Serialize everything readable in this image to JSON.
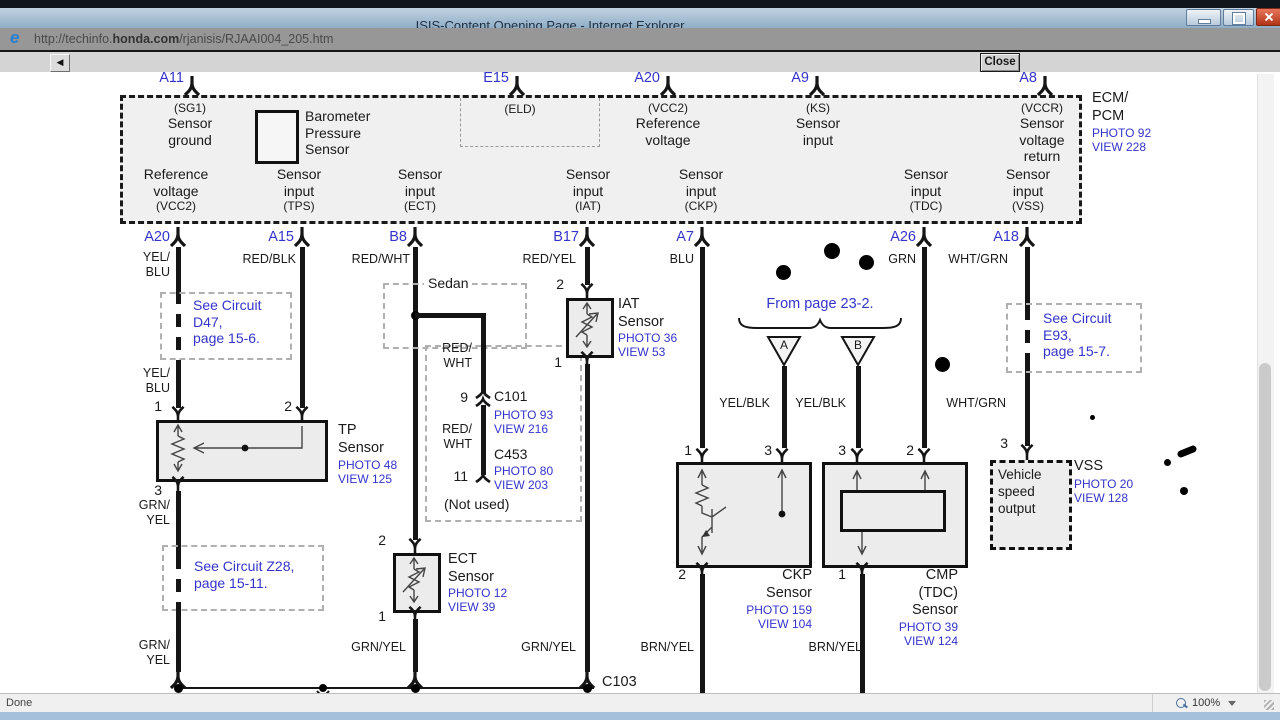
{
  "window": {
    "title": "ISIS-Content Opening Page - Internet Explorer",
    "ie_logo": "e",
    "url_prefix": "http://techinfo.",
    "url_domain": "honda.com",
    "url_suffix": "/rjanisis/RJAAI004_205.htm"
  },
  "toolbar": {
    "back_icon": "◀",
    "close_label": "Close"
  },
  "statusbar": {
    "status": "Done",
    "zoom_level": "100%"
  },
  "ecm": {
    "title": "ECM/\nPCM",
    "photo": "PHOTO 92",
    "view": "VIEW 228",
    "barometer_label": "Barometer\nPressure\nSensor",
    "top_pins": [
      {
        "id": "A11",
        "sub": "(SG1)",
        "label": "Sensor\nground"
      },
      {
        "id": "E15",
        "sub": "(ELD)",
        "label": ""
      },
      {
        "id": "A20",
        "sub": "(VCC2)",
        "label": "Reference\nvoltage"
      },
      {
        "id": "A9",
        "sub": "(KS)",
        "label": "Sensor\ninput"
      },
      {
        "id": "A8",
        "sub": "(VCCR)",
        "label": "Sensor\nvoltage\nreturn"
      }
    ],
    "bottom_pins": [
      {
        "id": "A20",
        "label": "Reference\nvoltage",
        "sub": "(VCC2)",
        "wire": "YEL/\nBLU"
      },
      {
        "id": "A15",
        "label": "Sensor\ninput",
        "sub": "(TPS)",
        "wire": "RED/BLK"
      },
      {
        "id": "B8",
        "label": "Sensor\ninput",
        "sub": "(ECT)",
        "wire": "RED/WHT"
      },
      {
        "id": "B17",
        "label": "Sensor\ninput",
        "sub": "(IAT)",
        "wire": "RED/YEL"
      },
      {
        "id": "A7",
        "label": "Sensor\ninput",
        "sub": "(CKP)",
        "wire": "BLU"
      },
      {
        "id": "A26",
        "label": "Sensor\ninput",
        "sub": "(TDC)",
        "wire": "GRN"
      },
      {
        "id": "A18",
        "label": "Sensor\ninput",
        "sub": "(VSS)",
        "wire": "WHT/GRN"
      }
    ]
  },
  "notes": {
    "d47": "See Circuit\nD47,\npage 15-6.",
    "z28": "See Circuit Z28,\npage 15-11.",
    "e93": "See Circuit\nE93,\npage 15-7.",
    "from_page": "From page 23-2.",
    "sedan": "Sedan",
    "not_used": "(Not used)",
    "triangle_a": "A",
    "triangle_b": "B"
  },
  "wire_labels": {
    "yel_blu": "YEL/\nBLU",
    "grn_yel_2l": "GRN/\nYEL",
    "grn_yel": "GRN/YEL",
    "red_wht_2l": "RED/\nWHT",
    "yel_blk": "YEL/BLK",
    "wht_grn": "WHT/GRN",
    "brn_yel": "BRN/YEL"
  },
  "sensors": {
    "tp": {
      "name": "TP\nSensor",
      "photo": "PHOTO 48",
      "view": "VIEW 125",
      "pin_top_left": "1",
      "pin_top_right": "2",
      "pin_bottom": "3"
    },
    "iat": {
      "name": "IAT\nSensor",
      "photo": "PHOTO 36",
      "view": "VIEW 53",
      "pin_top": "2",
      "pin_bottom": "1"
    },
    "ect": {
      "name": "ECT\nSensor",
      "photo": "PHOTO 12",
      "view": "VIEW 39",
      "pin_top": "2",
      "pin_bottom": "1"
    },
    "ckp": {
      "name": "CKP\nSensor",
      "photo": "PHOTO 159",
      "view": "VIEW 104",
      "pin_top_left": "1",
      "pin_top_right": "3",
      "pin_bottom": "2"
    },
    "cmp": {
      "name": "CMP\n(TDC)\nSensor",
      "photo": "PHOTO 39",
      "view": "VIEW 124",
      "pin_top_left": "3",
      "pin_top_right": "2",
      "pin_bottom": "1"
    },
    "vss": {
      "name": "VSS",
      "photo": "PHOTO 20",
      "view": "VIEW 128",
      "box_label": "Vehicle\nspeed\noutput",
      "pin_top": "3"
    }
  },
  "connectors": {
    "c101": {
      "pin": "9",
      "name": "C101",
      "photo": "PHOTO 93",
      "view": "VIEW 216"
    },
    "c453": {
      "pin": "11",
      "name": "C453",
      "photo": "PHOTO 80",
      "view": "VIEW 203"
    },
    "c103": "C103"
  }
}
